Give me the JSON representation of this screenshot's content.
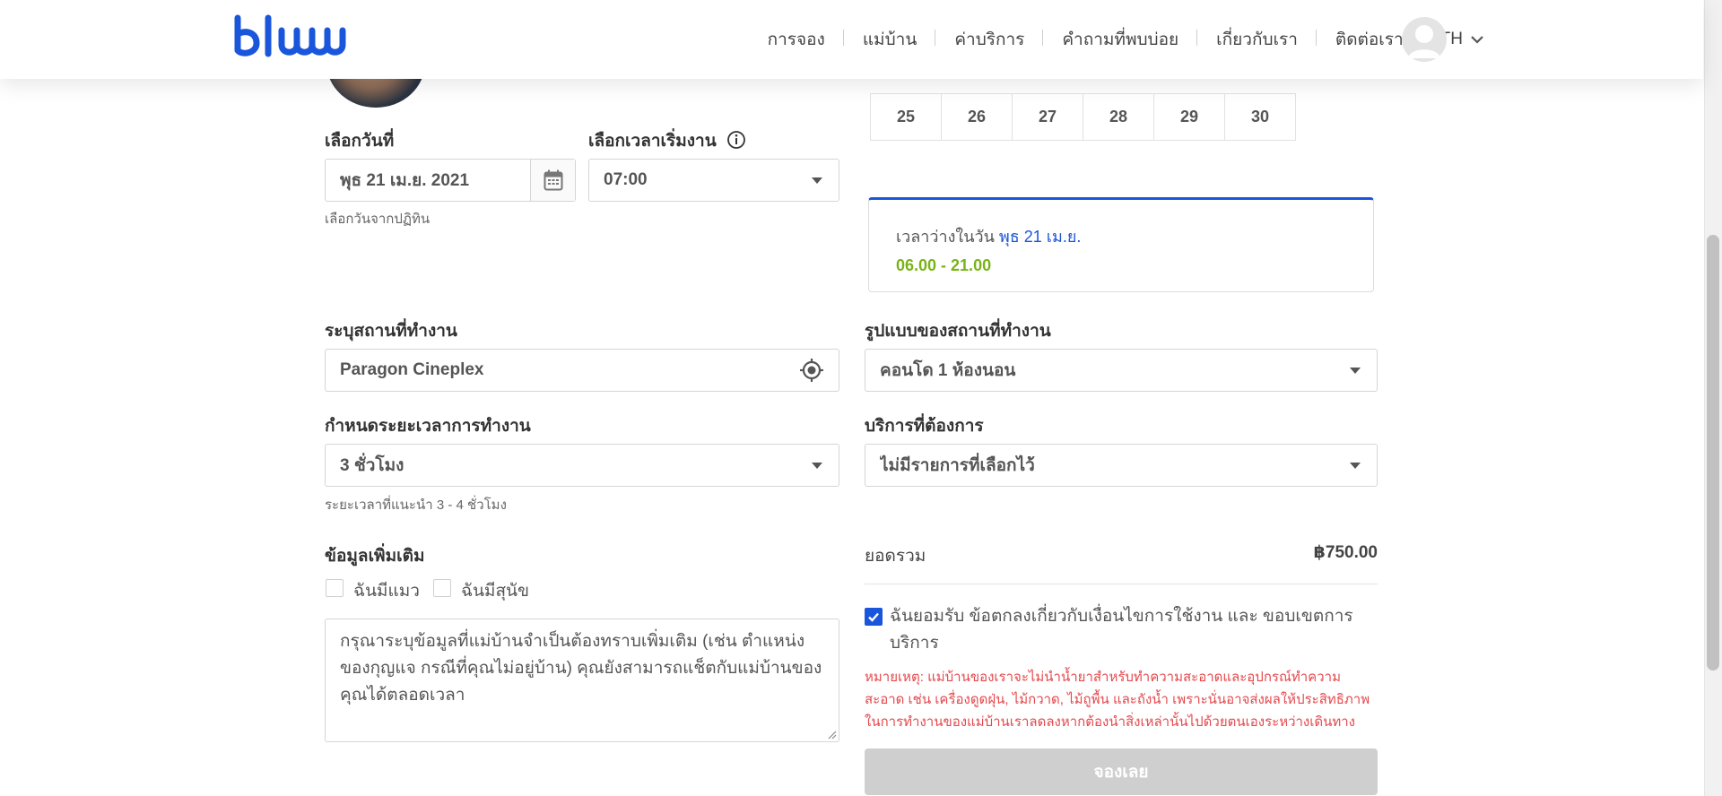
{
  "header": {
    "logo_text": "bluu",
    "nav": [
      "การจอง",
      "แม่บ้าน",
      "ค่าบริการ",
      "คำถามที่พบบ่อย",
      "เกี่ยวกับเรา",
      "ติดต่อเรา"
    ],
    "language": "TH"
  },
  "calendar": {
    "visible_days": [
      "25",
      "26",
      "27",
      "28",
      "29",
      "30"
    ],
    "selected_day_index": 3
  },
  "date_field": {
    "label": "เลือกวันที่",
    "value": "พุธ 21 เม.ย. 2021",
    "helper": "เลือกวันจากปฏิทิน"
  },
  "time_field": {
    "label": "เลือกเวลาเริ่มงาน",
    "value": "07:00"
  },
  "availability": {
    "prefix": "เวลาว่างในวัน ",
    "date": "พุธ 21 เม.ย.",
    "hours": "06.00 - 21.00"
  },
  "location": {
    "label": "ระบุสถานที่ทำงาน",
    "value": "Paragon Cineplex"
  },
  "property_type": {
    "label": "รูปแบบของสถานที่ทำงาน",
    "value": "คอนโด 1 ห้องนอน"
  },
  "duration": {
    "label": "กำหนดระยะเวลาการทำงาน",
    "value": "3 ชั่วโมง",
    "helper": "ระยะเวลาที่แนะนำ 3 - 4 ชั่วโมง"
  },
  "services": {
    "label": "บริการที่ต้องการ",
    "value": "ไม่มีรายการที่เลือกไว้"
  },
  "additional": {
    "label": "ข้อมูลเพิ่มเติม",
    "has_cat": "ฉันมีแมว",
    "has_dog": "ฉันมีสุนัข",
    "notes_placeholder": "กรุณาระบุข้อมูลที่แม่บ้านจำเป็นต้องทราบเพิ่มเติม (เช่น ตำแหน่งของกุญแจ กรณีที่คุณไม่อยู่บ้าน) คุณยังสามารถแช็ตกับแม่บ้านของคุณได้ตลอดเวลา"
  },
  "summary": {
    "total_label": "ยอดรวม",
    "total_value": "฿750.00",
    "terms_text": "ฉันยอมรับ ข้อตกลงเกี่ยวกับเงื่อนไขการใช้งาน และ ขอบเขตการบริการ",
    "terms_checked": true,
    "note": "หมายเหตุ: แม่บ้านของเราจะไม่นำน้ำยาสำหรับทำความสะอาดและอุปกรณ์ทำความสะอาด เช่น เครื่องดูดฝุ่น, ไม้กวาด, ไม้ถูพื้น และถังน้ำ เพราะนั่นอาจส่งผลให้ประสิทธิภาพในการทำงานของแม่บ้านเราลดลงหากต้องนำสิ่งเหล่านั้นไปด้วยตนเองระหว่างเดินทาง",
    "book_button": "จองเลย"
  },
  "colors": {
    "accent": "#1a56db",
    "hours": "#7ab317",
    "warning": "#e5484d",
    "disabled_button": "#cfcfcf"
  }
}
